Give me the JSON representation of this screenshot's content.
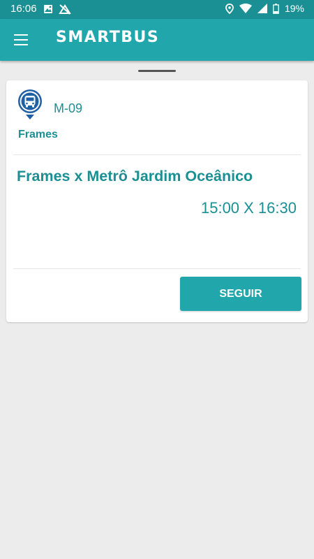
{
  "status_bar": {
    "time": "16:06",
    "battery": "19%",
    "icons": [
      "image-icon",
      "no-network-icon",
      "location-icon",
      "wifi-icon",
      "signal-icon",
      "battery-icon"
    ]
  },
  "app_bar": {
    "menu_icon": "hamburger-menu-icon",
    "title": "SMARTBUS"
  },
  "card": {
    "icon": "bus-location-icon",
    "line_code": "M-09",
    "company": "Frames",
    "route_name": "Frames x Metrô Jardim Oceânico",
    "schedule": "15:00 X 16:30",
    "action_label": "SEGUIR"
  },
  "colors": {
    "status_bar": "#1a8f94",
    "app_bar": "#20a6ab",
    "accent_text": "#1a8f94",
    "icon_blue": "#1f5fa3",
    "background": "#ececec"
  }
}
